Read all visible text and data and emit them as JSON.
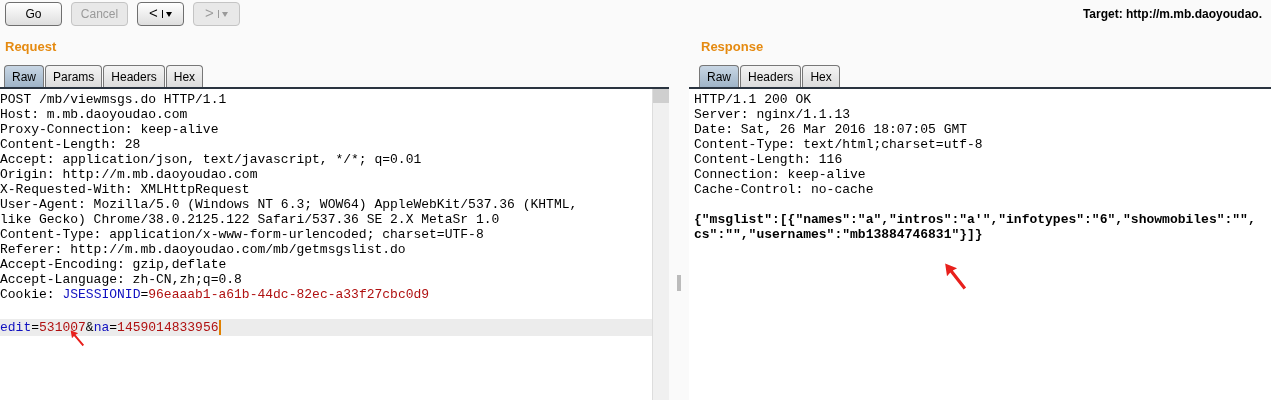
{
  "toolbar": {
    "buttons": [
      {
        "kind": "text",
        "label": "Go",
        "disabled": false
      },
      {
        "kind": "text",
        "label": "Cancel",
        "disabled": true
      },
      {
        "kind": "nav",
        "label": "<",
        "disabled": false
      },
      {
        "kind": "nav",
        "label": ">",
        "disabled": true
      }
    ],
    "target": "Target: http://m.mb.daoyoudao."
  },
  "request": {
    "title": "Request",
    "tabs": [
      {
        "label": "Raw",
        "selected": true
      },
      {
        "label": "Params",
        "selected": false
      },
      {
        "label": "Headers",
        "selected": false
      },
      {
        "label": "Hex",
        "selected": false
      }
    ],
    "lines": [
      {
        "kind": "text",
        "current": false,
        "segments": [
          {
            "kind": "plain",
            "text": "POST /mb/viewmsgs.do HTTP/1.1"
          }
        ]
      },
      {
        "kind": "text",
        "current": false,
        "segments": [
          {
            "kind": "plain",
            "text": "Host: m.mb.daoyoudao.com"
          }
        ]
      },
      {
        "kind": "text",
        "current": false,
        "segments": [
          {
            "kind": "plain",
            "text": "Proxy-Connection: keep-alive"
          }
        ]
      },
      {
        "kind": "text",
        "current": false,
        "segments": [
          {
            "kind": "plain",
            "text": "Content-Length: 28"
          }
        ]
      },
      {
        "kind": "text",
        "current": false,
        "segments": [
          {
            "kind": "plain",
            "text": "Accept: application/json, text/javascript, */*; q=0.01"
          }
        ]
      },
      {
        "kind": "text",
        "current": false,
        "segments": [
          {
            "kind": "plain",
            "text": "Origin: http://m.mb.daoyoudao.com"
          }
        ]
      },
      {
        "kind": "text",
        "current": false,
        "segments": [
          {
            "kind": "plain",
            "text": "X-Requested-With: XMLHttpRequest"
          }
        ]
      },
      {
        "kind": "text",
        "current": false,
        "segments": [
          {
            "kind": "plain",
            "text": "User-Agent: Mozilla/5.0 (Windows NT 6.3; WOW64) AppleWebKit/537.36 (KHTML,"
          }
        ]
      },
      {
        "kind": "text",
        "current": false,
        "segments": [
          {
            "kind": "plain",
            "text": "like Gecko) Chrome/38.0.2125.122 Safari/537.36 SE 2.X MetaSr 1.0"
          }
        ]
      },
      {
        "kind": "text",
        "current": false,
        "segments": [
          {
            "kind": "plain",
            "text": "Content-Type: application/x-www-form-urlencoded; charset=UTF-8"
          }
        ]
      },
      {
        "kind": "text",
        "current": false,
        "segments": [
          {
            "kind": "plain",
            "text": "Referer: http://m.mb.daoyoudao.com/mb/getmsgslist.do"
          }
        ]
      },
      {
        "kind": "text",
        "current": false,
        "segments": [
          {
            "kind": "plain",
            "text": "Accept-Encoding: gzip,deflate"
          }
        ]
      },
      {
        "kind": "text",
        "current": false,
        "segments": [
          {
            "kind": "plain",
            "text": "Accept-Language: zh-CN,zh;q=0.8"
          }
        ]
      },
      {
        "kind": "text",
        "current": false,
        "segments": [
          {
            "kind": "plain",
            "text": "Cookie: "
          },
          {
            "kind": "name",
            "text": "JSESSIONID"
          },
          {
            "kind": "plain",
            "text": "="
          },
          {
            "kind": "value",
            "text": "96eaaab1-a61b-44dc-82ec-a33f27cbc0d9"
          }
        ]
      },
      {
        "kind": "blank"
      },
      {
        "kind": "text",
        "current": true,
        "segments": [
          {
            "kind": "name",
            "text": "edit"
          },
          {
            "kind": "plain",
            "text": "="
          },
          {
            "kind": "value",
            "text": "531007"
          },
          {
            "kind": "plain",
            "text": "&"
          },
          {
            "kind": "name",
            "text": "na"
          },
          {
            "kind": "plain",
            "text": "="
          },
          {
            "kind": "value",
            "text": "1459014833956"
          }
        ]
      }
    ]
  },
  "response": {
    "title": "Response",
    "tabs": [
      {
        "label": "Raw",
        "selected": true
      },
      {
        "label": "Headers",
        "selected": false
      },
      {
        "label": "Hex",
        "selected": false
      }
    ],
    "lines": [
      {
        "kind": "text",
        "current": false,
        "segments": [
          {
            "kind": "plain",
            "text": "HTTP/1.1 200 OK"
          }
        ]
      },
      {
        "kind": "text",
        "current": false,
        "segments": [
          {
            "kind": "plain",
            "text": "Server: nginx/1.1.13"
          }
        ]
      },
      {
        "kind": "text",
        "current": false,
        "segments": [
          {
            "kind": "plain",
            "text": "Date: Sat, 26 Mar 2016 18:07:05 GMT"
          }
        ]
      },
      {
        "kind": "text",
        "current": false,
        "segments": [
          {
            "kind": "plain",
            "text": "Content-Type: text/html;charset=utf-8"
          }
        ]
      },
      {
        "kind": "text",
        "current": false,
        "segments": [
          {
            "kind": "plain",
            "text": "Content-Length: 116"
          }
        ]
      },
      {
        "kind": "text",
        "current": false,
        "segments": [
          {
            "kind": "plain",
            "text": "Connection: keep-alive"
          }
        ]
      },
      {
        "kind": "text",
        "current": false,
        "segments": [
          {
            "kind": "plain",
            "text": "Cache-Control: no-cache"
          }
        ]
      },
      {
        "kind": "blank"
      },
      {
        "kind": "text",
        "current": false,
        "segments": [
          {
            "kind": "bold",
            "text": "{\"msglist\":[{\"names\":\"a\",\"intros\":\"a'\",\"infotypes\":\"6\",\"showmobiles\":\"\","
          }
        ]
      },
      {
        "kind": "text",
        "current": false,
        "segments": [
          {
            "kind": "bold",
            "text": "cs\":\"\",\"usernames\":\"mb13884746831\"}]}"
          }
        ]
      }
    ]
  }
}
